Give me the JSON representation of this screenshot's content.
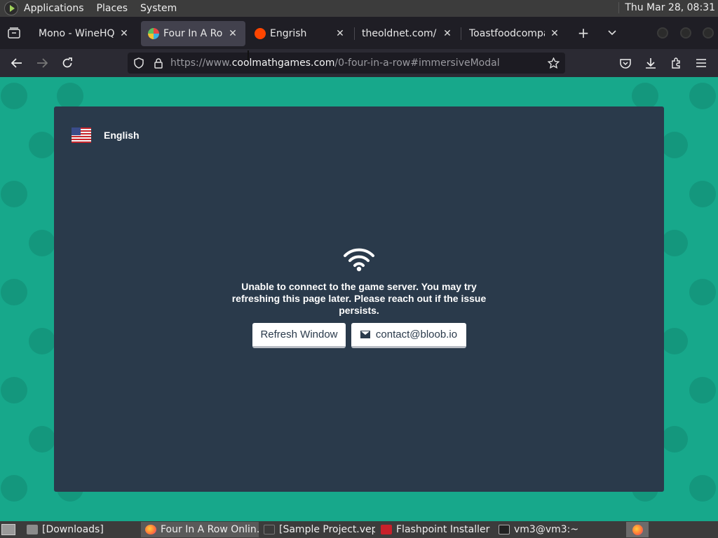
{
  "top_panel": {
    "menus": [
      "Applications",
      "Places",
      "System"
    ],
    "clock": "Thu Mar 28, 08:31"
  },
  "browser": {
    "tabs": [
      {
        "title": "Mono - WineHQ Wiki",
        "active": false
      },
      {
        "title": "Four In A Row Game",
        "active": true
      },
      {
        "title": "Engrish",
        "active": false
      },
      {
        "title": "theoldnet.com/",
        "active": false
      },
      {
        "title": "Toastfoodcompany",
        "active": false
      }
    ],
    "url": {
      "prefix": "https://www.",
      "host": "coolmathgames.com",
      "path": "/0-four-in-a-row#immersiveModal"
    }
  },
  "modal": {
    "language": "English",
    "message": "Unable to connect to the game server. You may try refreshing this page later. Please reach out if the issue persists.",
    "refresh_label": "Refresh Window",
    "contact_label": "contact@bloob.io"
  },
  "taskbar": {
    "items": [
      {
        "label": "[Downloads]"
      },
      {
        "label": "Four In A Row Onlin…"
      },
      {
        "label": "[Sample Project.vep…"
      },
      {
        "label": "Flashpoint Installer"
      },
      {
        "label": "vm3@vm3:~"
      }
    ]
  },
  "colors": {
    "page_background": "#17a88b",
    "modal_background": "#2a3a4b",
    "browser_chrome": "#2b2a33"
  }
}
